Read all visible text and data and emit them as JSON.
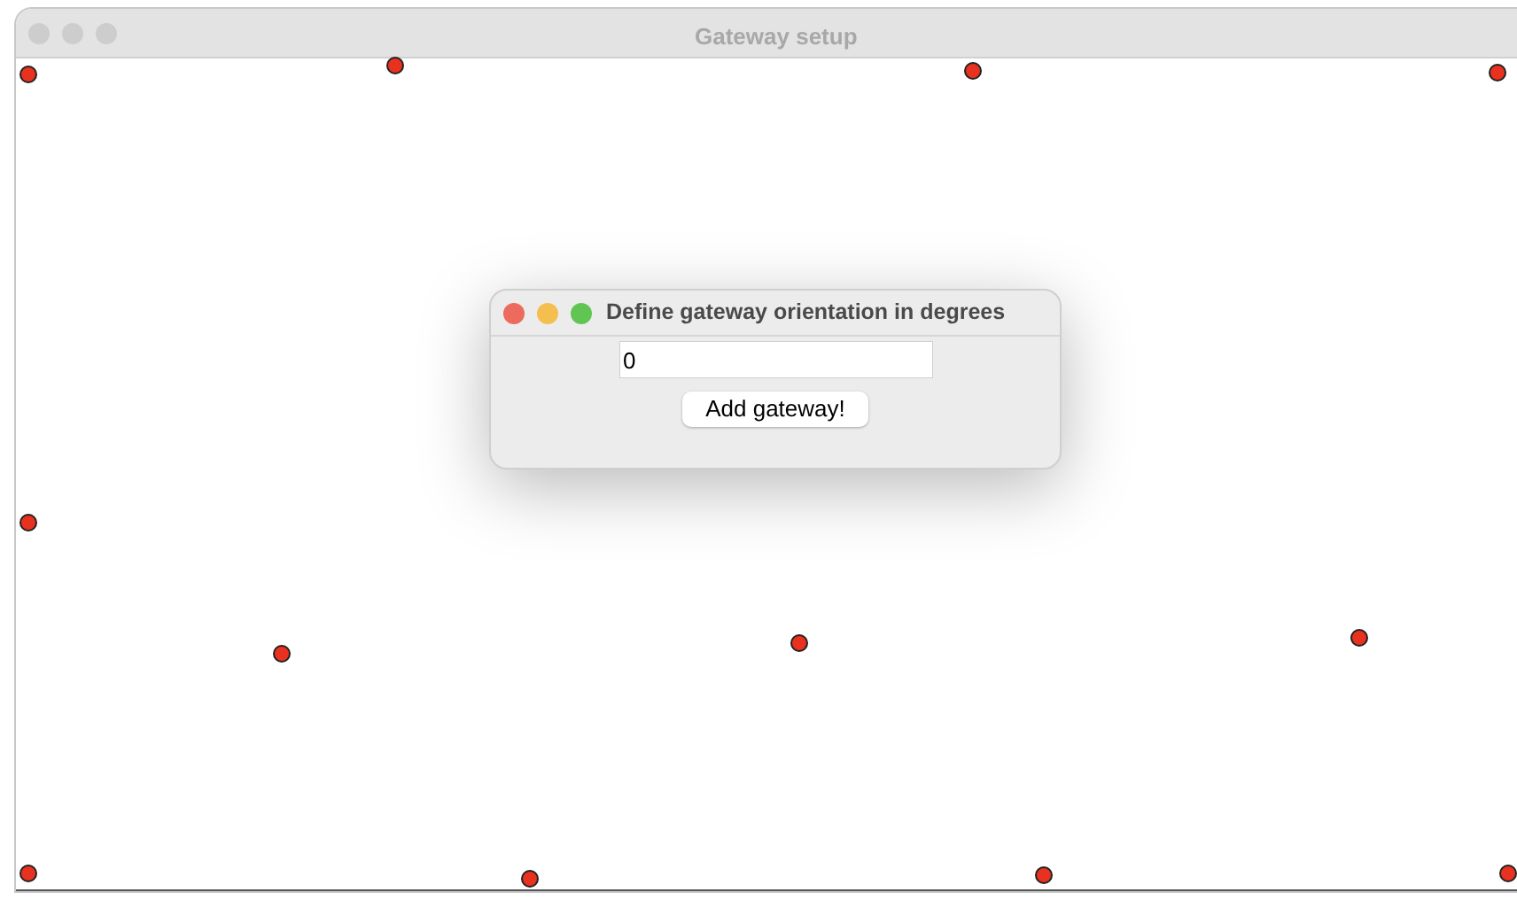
{
  "window": {
    "title": "Gateway setup"
  },
  "dialog": {
    "title": "Define gateway orientation in degrees",
    "orientation_field": {
      "value": "0"
    },
    "button": "Add gateway!"
  }
}
